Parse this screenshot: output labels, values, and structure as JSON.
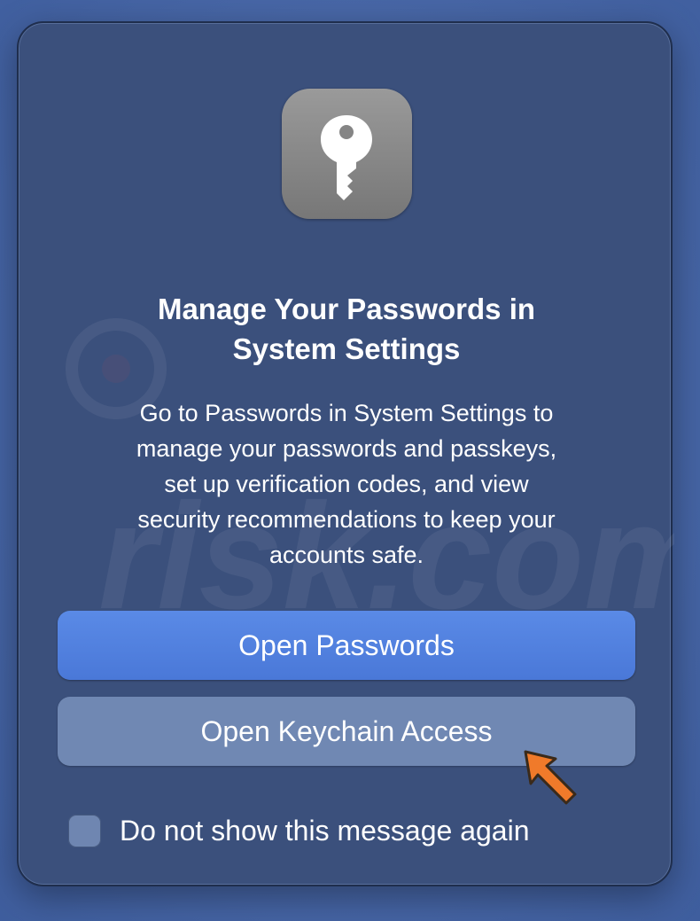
{
  "dialog": {
    "icon": "key-icon",
    "title_line1": "Manage Your Passwords in",
    "title_line2": "System Settings",
    "body_lines": [
      "Go to Passwords in System Settings to",
      "manage your passwords and passkeys,",
      "set up verification codes, and view",
      "security recommendations to keep your",
      "accounts safe."
    ],
    "primary_button": "Open Passwords",
    "secondary_button": "Open Keychain Access",
    "checkbox_label": "Do not show this message again",
    "checkbox_checked": false
  },
  "annotation": {
    "icon": "arrow-pointer-icon",
    "color": "#f07a2a"
  },
  "colors": {
    "background": "#4a6aa8",
    "dialog": "#3b507c",
    "primary_button": "#4f7fe0",
    "secondary_button": "#7088b3"
  }
}
